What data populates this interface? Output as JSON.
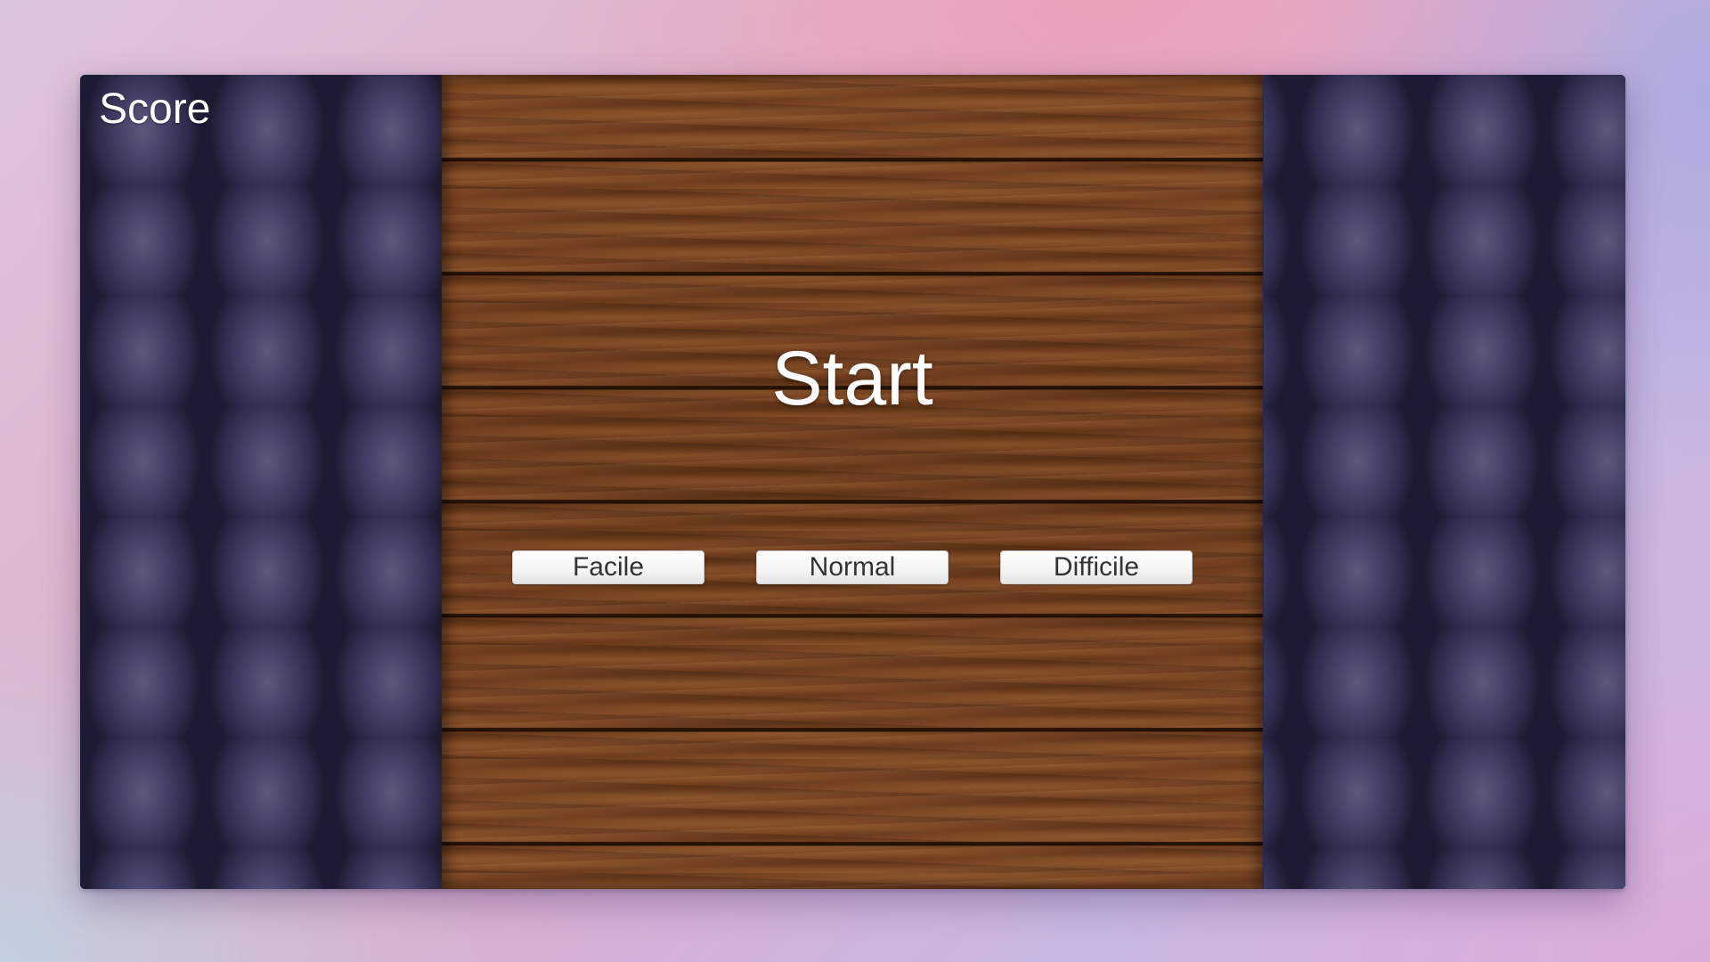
{
  "hud": {
    "score_label": "Score"
  },
  "menu": {
    "title": "Start",
    "difficulty_buttons": [
      {
        "label": "Facile"
      },
      {
        "label": "Normal"
      },
      {
        "label": "Difficile"
      }
    ]
  },
  "colors": {
    "wood": "#6e3f1f",
    "scales": "#2f2d4d",
    "button_bg": "#f4f4f4",
    "button_text": "#333333",
    "text": "#ffffff"
  }
}
